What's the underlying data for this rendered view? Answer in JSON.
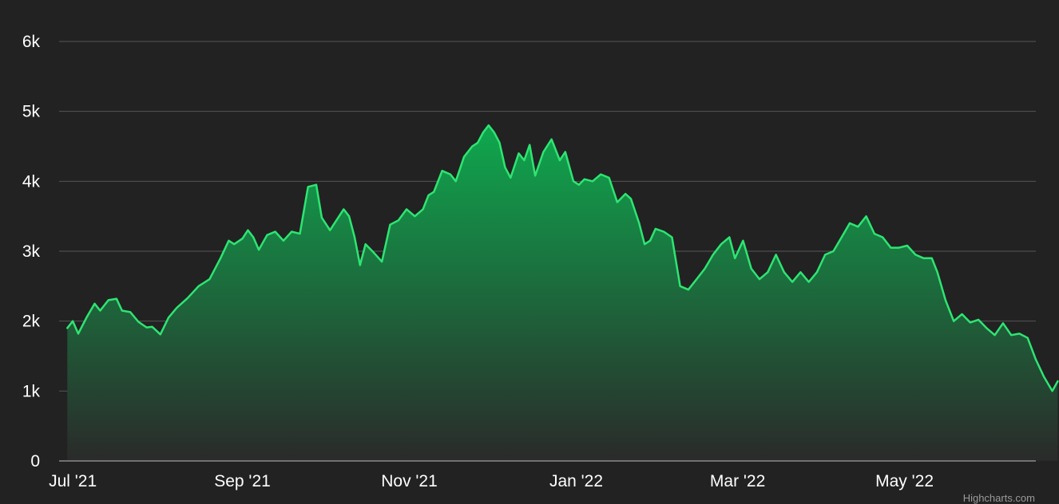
{
  "chart_data": {
    "type": "area",
    "title": "",
    "xlabel": "",
    "ylabel": "",
    "ylim": [
      0,
      6000
    ],
    "yticks": [
      0,
      1000,
      2000,
      3000,
      4000,
      5000,
      6000
    ],
    "ytick_labels": [
      "0",
      "1k",
      "2k",
      "3k",
      "4k",
      "5k",
      "6k"
    ],
    "xlim": [
      "2021-06-26",
      "2022-06-18"
    ],
    "xticks": [
      "2021-07-01",
      "2021-09-01",
      "2021-11-01",
      "2022-01-01",
      "2022-03-01",
      "2022-05-01"
    ],
    "xtick_labels": [
      "Jul '21",
      "Sep '21",
      "Nov '21",
      "Jan '22",
      "Mar '22",
      "May '22"
    ],
    "grid": true,
    "legend": "none",
    "colors": {
      "background": "#222222",
      "line": "#2ee572",
      "area_top": "#0fa84e",
      "area_bottom": "#2a2a2a",
      "grid": "#555555",
      "text": "#ffffff"
    },
    "series": [
      {
        "points": [
          [
            "2021-06-29",
            1900
          ],
          [
            "2021-07-01",
            2000
          ],
          [
            "2021-07-03",
            1820
          ],
          [
            "2021-07-06",
            2050
          ],
          [
            "2021-07-09",
            2250
          ],
          [
            "2021-07-11",
            2150
          ],
          [
            "2021-07-14",
            2300
          ],
          [
            "2021-07-17",
            2320
          ],
          [
            "2021-07-19",
            2150
          ],
          [
            "2021-07-22",
            2130
          ],
          [
            "2021-07-25",
            1990
          ],
          [
            "2021-07-28",
            1910
          ],
          [
            "2021-07-30",
            1920
          ],
          [
            "2021-08-02",
            1810
          ],
          [
            "2021-08-05",
            2050
          ],
          [
            "2021-08-08",
            2190
          ],
          [
            "2021-08-12",
            2330
          ],
          [
            "2021-08-16",
            2500
          ],
          [
            "2021-08-20",
            2600
          ],
          [
            "2021-08-24",
            2900
          ],
          [
            "2021-08-27",
            3150
          ],
          [
            "2021-08-29",
            3100
          ],
          [
            "2021-09-01",
            3180
          ],
          [
            "2021-09-03",
            3300
          ],
          [
            "2021-09-05",
            3200
          ],
          [
            "2021-09-07",
            3020
          ],
          [
            "2021-09-10",
            3230
          ],
          [
            "2021-09-13",
            3280
          ],
          [
            "2021-09-16",
            3150
          ],
          [
            "2021-09-19",
            3280
          ],
          [
            "2021-09-22",
            3250
          ],
          [
            "2021-09-25",
            3920
          ],
          [
            "2021-09-28",
            3950
          ],
          [
            "2021-09-30",
            3480
          ],
          [
            "2021-10-03",
            3300
          ],
          [
            "2021-10-05",
            3420
          ],
          [
            "2021-10-08",
            3600
          ],
          [
            "2021-10-10",
            3500
          ],
          [
            "2021-10-12",
            3200
          ],
          [
            "2021-10-14",
            2800
          ],
          [
            "2021-10-16",
            3100
          ],
          [
            "2021-10-19",
            2980
          ],
          [
            "2021-10-22",
            2850
          ],
          [
            "2021-10-25",
            3380
          ],
          [
            "2021-10-28",
            3440
          ],
          [
            "2021-10-31",
            3600
          ],
          [
            "2021-11-03",
            3500
          ],
          [
            "2021-11-06",
            3600
          ],
          [
            "2021-11-08",
            3800
          ],
          [
            "2021-11-10",
            3850
          ],
          [
            "2021-11-13",
            4150
          ],
          [
            "2021-11-16",
            4100
          ],
          [
            "2021-11-18",
            4000
          ],
          [
            "2021-11-21",
            4350
          ],
          [
            "2021-11-24",
            4500
          ],
          [
            "2021-11-26",
            4550
          ],
          [
            "2021-11-28",
            4700
          ],
          [
            "2021-11-30",
            4800
          ],
          [
            "2021-12-02",
            4700
          ],
          [
            "2021-12-04",
            4550
          ],
          [
            "2021-12-06",
            4200
          ],
          [
            "2021-12-08",
            4050
          ],
          [
            "2021-12-11",
            4400
          ],
          [
            "2021-12-13",
            4300
          ],
          [
            "2021-12-15",
            4520
          ],
          [
            "2021-12-17",
            4080
          ],
          [
            "2021-12-20",
            4420
          ],
          [
            "2021-12-23",
            4600
          ],
          [
            "2021-12-26",
            4300
          ],
          [
            "2021-12-28",
            4420
          ],
          [
            "2021-12-31",
            4000
          ],
          [
            "2022-01-02",
            3950
          ],
          [
            "2022-01-04",
            4030
          ],
          [
            "2022-01-07",
            4000
          ],
          [
            "2022-01-10",
            4100
          ],
          [
            "2022-01-13",
            4050
          ],
          [
            "2022-01-16",
            3700
          ],
          [
            "2022-01-19",
            3820
          ],
          [
            "2022-01-21",
            3750
          ],
          [
            "2022-01-24",
            3400
          ],
          [
            "2022-01-26",
            3100
          ],
          [
            "2022-01-28",
            3150
          ],
          [
            "2022-01-30",
            3320
          ],
          [
            "2022-02-02",
            3280
          ],
          [
            "2022-02-05",
            3200
          ],
          [
            "2022-02-08",
            2500
          ],
          [
            "2022-02-11",
            2450
          ],
          [
            "2022-02-14",
            2600
          ],
          [
            "2022-02-17",
            2750
          ],
          [
            "2022-02-20",
            2950
          ],
          [
            "2022-02-23",
            3100
          ],
          [
            "2022-02-26",
            3200
          ],
          [
            "2022-02-28",
            2900
          ],
          [
            "2022-03-03",
            3150
          ],
          [
            "2022-03-06",
            2750
          ],
          [
            "2022-03-09",
            2600
          ],
          [
            "2022-03-12",
            2700
          ],
          [
            "2022-03-15",
            2950
          ],
          [
            "2022-03-18",
            2700
          ],
          [
            "2022-03-21",
            2560
          ],
          [
            "2022-03-24",
            2700
          ],
          [
            "2022-03-27",
            2560
          ],
          [
            "2022-03-30",
            2700
          ],
          [
            "2022-04-02",
            2950
          ],
          [
            "2022-04-05",
            3000
          ],
          [
            "2022-04-08",
            3200
          ],
          [
            "2022-04-11",
            3400
          ],
          [
            "2022-04-14",
            3350
          ],
          [
            "2022-04-17",
            3500
          ],
          [
            "2022-04-20",
            3250
          ],
          [
            "2022-04-23",
            3200
          ],
          [
            "2022-04-26",
            3050
          ],
          [
            "2022-04-29",
            3050
          ],
          [
            "2022-05-02",
            3080
          ],
          [
            "2022-05-05",
            2950
          ],
          [
            "2022-05-08",
            2900
          ],
          [
            "2022-05-11",
            2900
          ],
          [
            "2022-05-13",
            2700
          ],
          [
            "2022-05-16",
            2300
          ],
          [
            "2022-05-19",
            2000
          ],
          [
            "2022-05-22",
            2100
          ],
          [
            "2022-05-25",
            1980
          ],
          [
            "2022-05-28",
            2020
          ],
          [
            "2022-05-31",
            1900
          ],
          [
            "2022-06-03",
            1800
          ],
          [
            "2022-06-06",
            1970
          ],
          [
            "2022-06-09",
            1800
          ],
          [
            "2022-06-12",
            1820
          ],
          [
            "2022-06-15",
            1760
          ],
          [
            "2022-06-18",
            1450
          ],
          [
            "2022-06-21",
            1200
          ],
          [
            "2022-06-24",
            1000
          ],
          [
            "2022-06-26",
            1140
          ]
        ]
      }
    ]
  },
  "credits": "Highcharts.com"
}
